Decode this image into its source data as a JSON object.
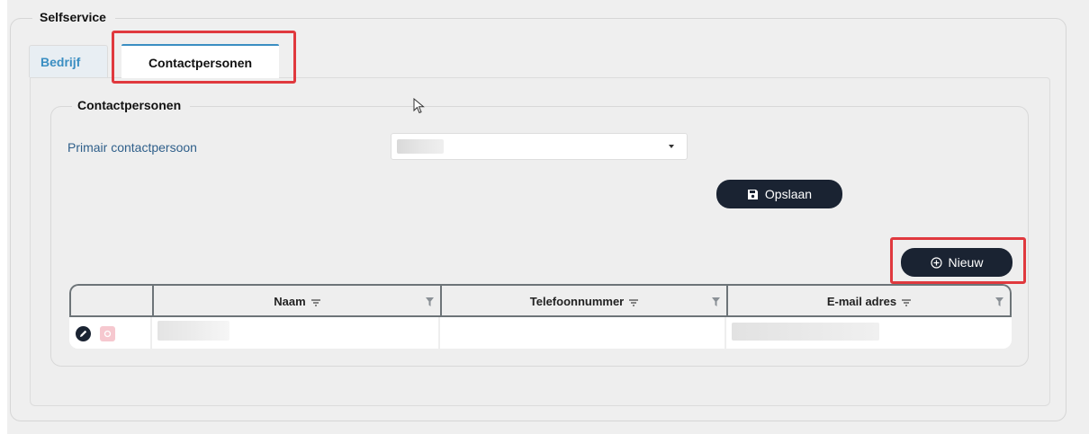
{
  "section": {
    "title": "Selfservice"
  },
  "tabs": [
    {
      "label": "Bedrijf",
      "active": false
    },
    {
      "label": "Contactpersonen",
      "active": true
    }
  ],
  "contact_section": {
    "title": "Contactpersonen",
    "primary_contact_label": "Primair contactpersoon",
    "primary_contact_value": ""
  },
  "buttons": {
    "save_label": "Opslaan",
    "new_label": "Nieuw"
  },
  "grid": {
    "columns": [
      "",
      "Naam",
      "Telefoonnummer",
      "E-mail adres"
    ],
    "rows": [
      {
        "naam": "",
        "telefoonnummer": "",
        "email": ""
      }
    ]
  },
  "colors": {
    "accent": "#3a8ec2",
    "dark_button": "#1a2332",
    "highlight": "#e0393e",
    "delete": "#f6c8cf"
  },
  "icons": [
    "save-icon",
    "plus-circle-icon",
    "sort-icon",
    "filter-icon",
    "edit-icon",
    "delete-icon",
    "caret-down-icon",
    "mouse-cursor-icon"
  ]
}
